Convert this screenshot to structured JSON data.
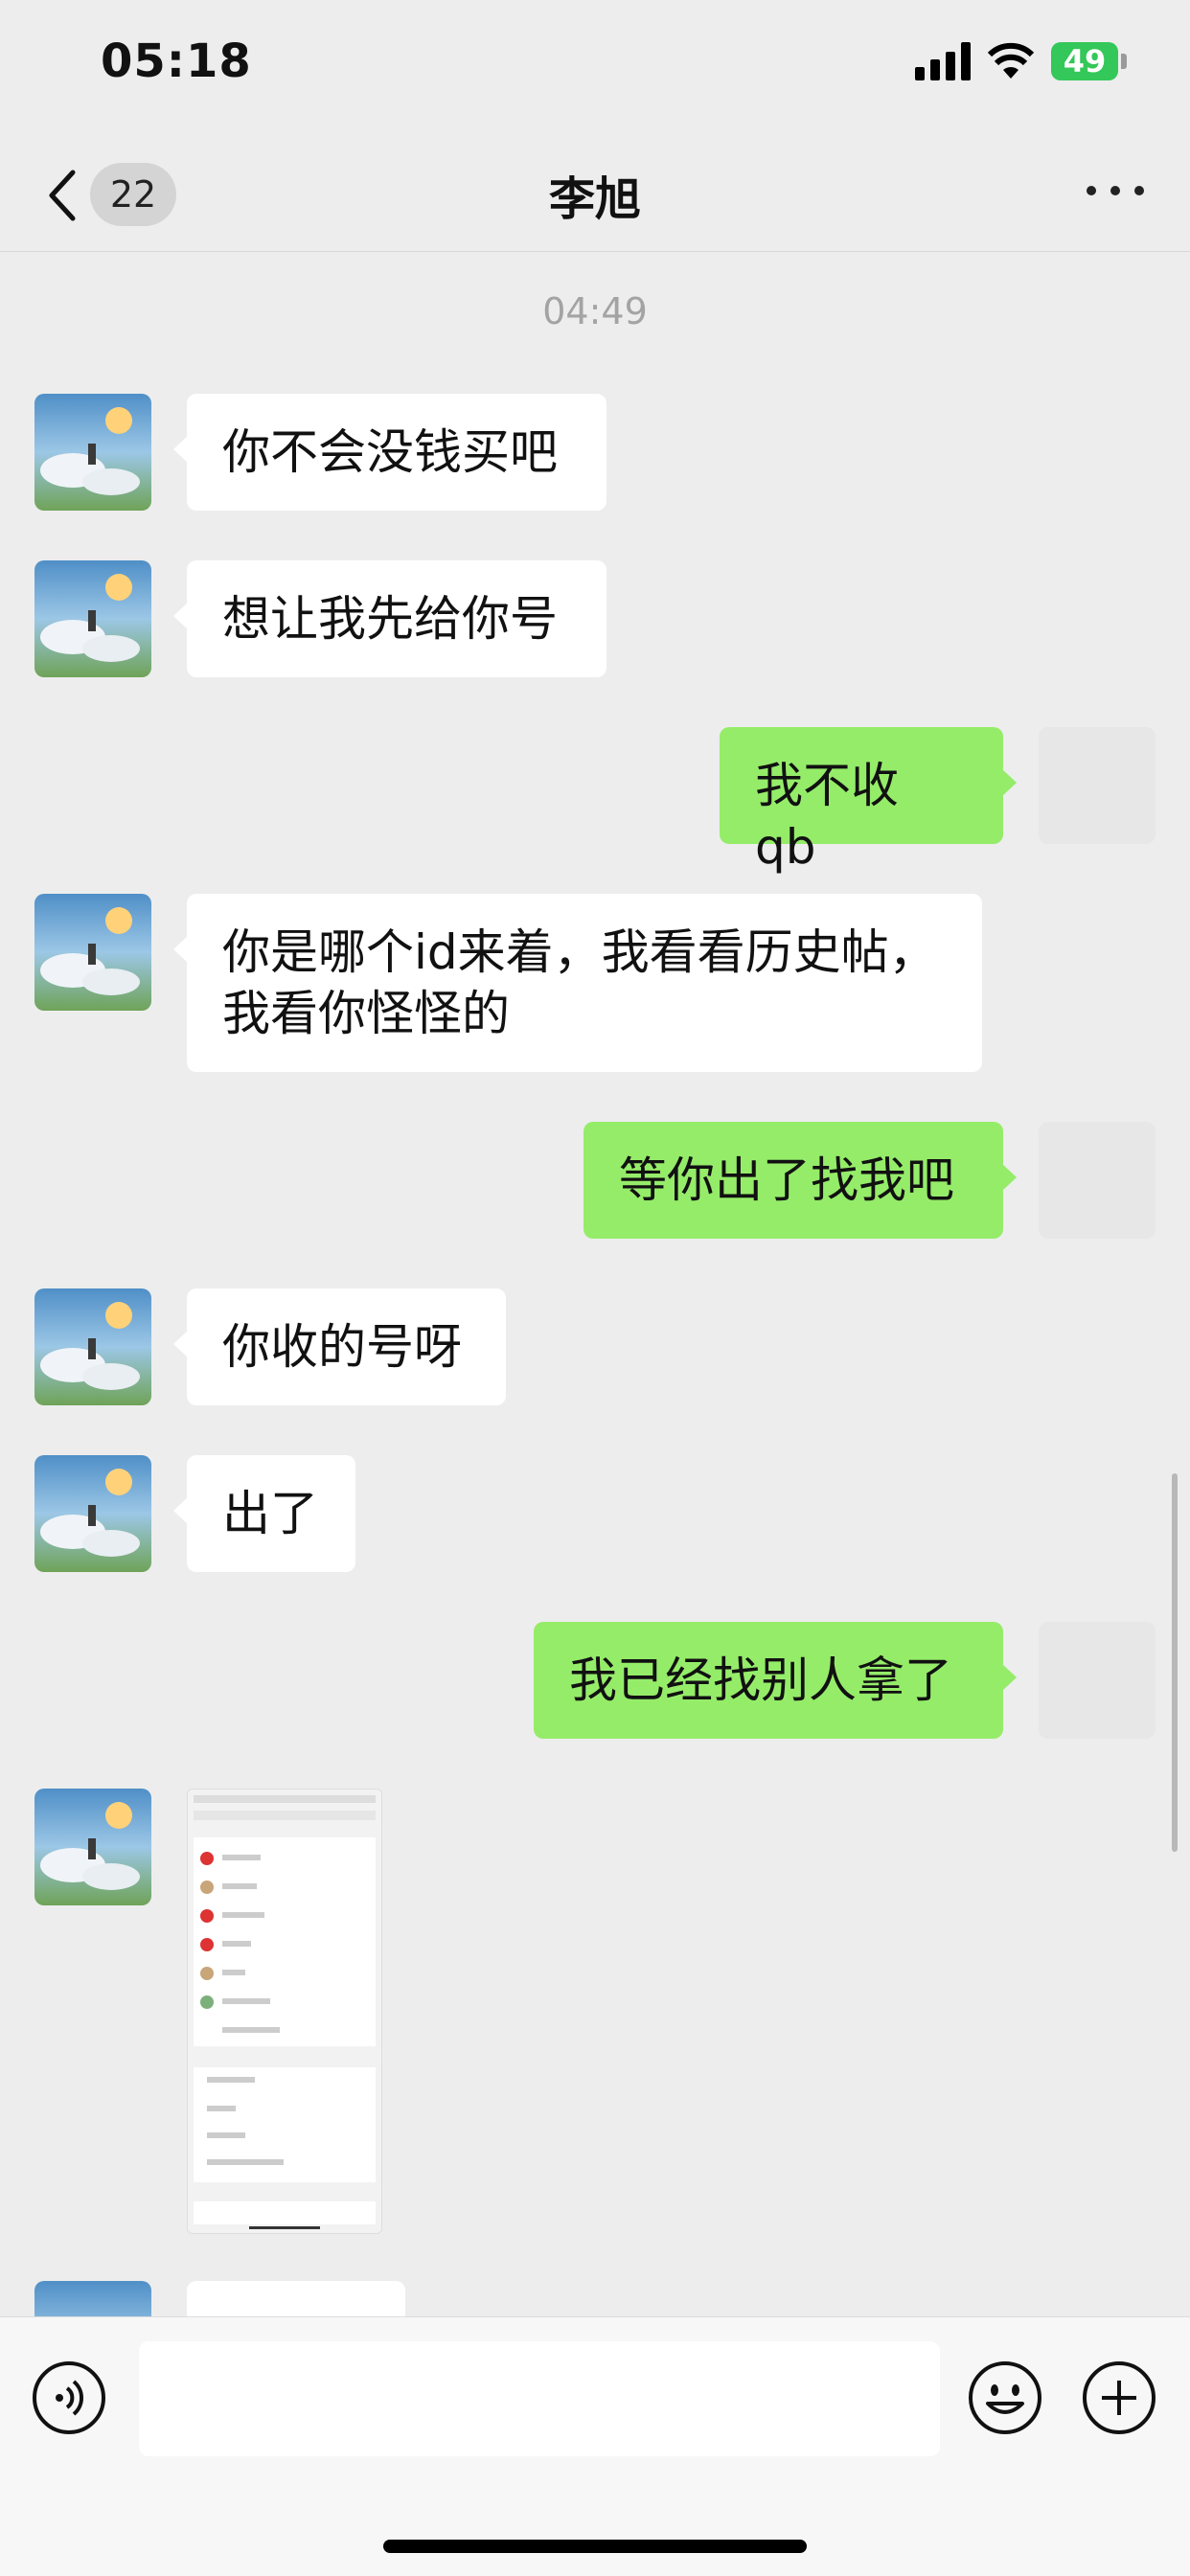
{
  "status_bar": {
    "time": "05:18",
    "battery": "49"
  },
  "nav": {
    "unread_count": "22",
    "title": "李旭"
  },
  "chat": {
    "timestamp": "04:49",
    "messages": [
      {
        "side": "in",
        "text": "你不会没钱买吧"
      },
      {
        "side": "in",
        "text": "想让我先给你号"
      },
      {
        "side": "out",
        "text": "我不收 qb"
      },
      {
        "side": "in",
        "text": "你是哪个id来着，我看看历史帖，我看你怪怪的"
      },
      {
        "side": "out",
        "text": "等你出了找我吧"
      },
      {
        "side": "in",
        "text": "你收的号呀"
      },
      {
        "side": "in",
        "text": "出了"
      },
      {
        "side": "out",
        "text": "我已经找别人拿了"
      },
      {
        "side": "in",
        "type": "image"
      }
    ]
  },
  "colors": {
    "outgoing_bubble": "#95ec69",
    "incoming_bubble": "#ffffff",
    "background": "#ededed"
  }
}
